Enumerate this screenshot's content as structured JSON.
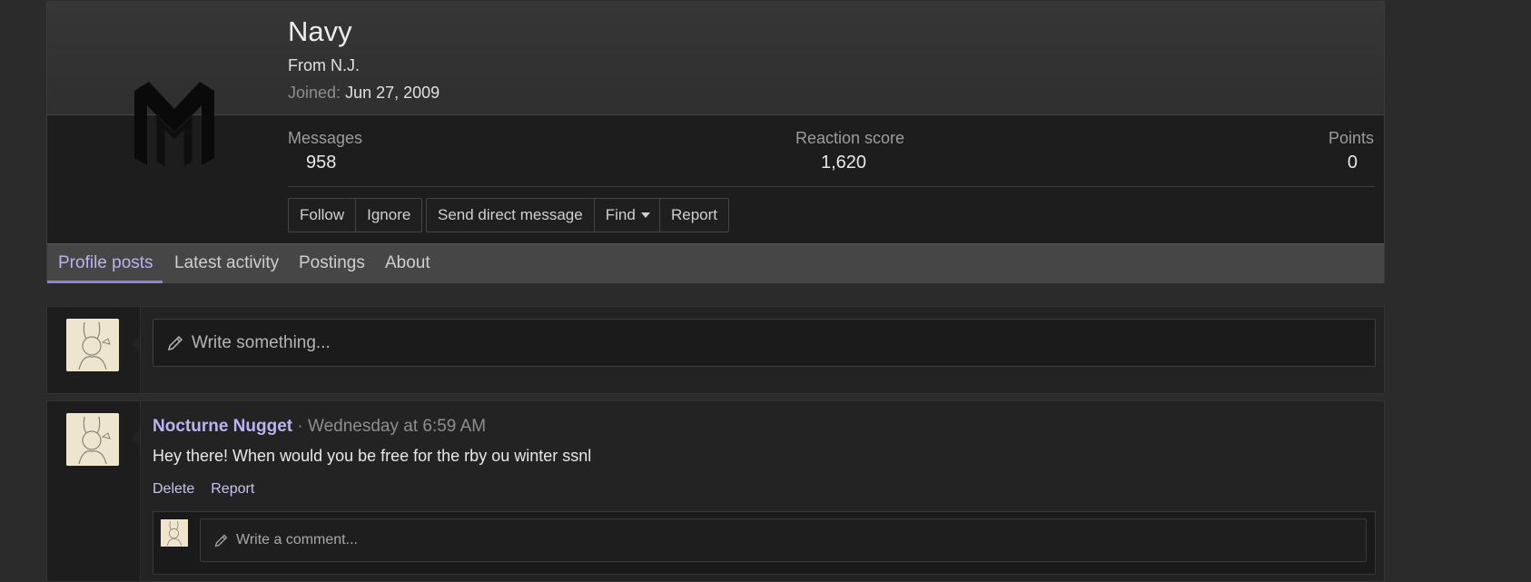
{
  "profile": {
    "username": "Navy",
    "location": "From N.J.",
    "joined_label": "Joined:",
    "joined_value": "Jun 27, 2009",
    "avatar_icon": "m-logo-icon",
    "stats": {
      "messages_label": "Messages",
      "messages_value": "958",
      "reaction_label": "Reaction score",
      "reaction_value": "1,620",
      "points_label": "Points",
      "points_value": "0"
    },
    "buttons": {
      "follow": "Follow",
      "ignore": "Ignore",
      "send_dm": "Send direct message",
      "find": "Find",
      "report": "Report"
    }
  },
  "tabs": [
    {
      "label": "Profile posts",
      "active": true
    },
    {
      "label": "Latest activity",
      "active": false
    },
    {
      "label": "Postings",
      "active": false
    },
    {
      "label": "About",
      "active": false
    }
  ],
  "compose": {
    "placeholder": "Write something...",
    "icon": "pencil-icon"
  },
  "post": {
    "author": "Nocturne Nugget",
    "separator": "·",
    "time": "Wednesday at 6:59 AM",
    "text": "Hey there! When would you be free for the rby ou winter ssnl",
    "actions": {
      "delete": "Delete",
      "report": "Report"
    },
    "comment_placeholder": "Write a comment..."
  },
  "colors": {
    "accent": "#b9b3f0",
    "tab_underline": "#8c85d9",
    "background": "#2b2b2b",
    "panel": "#1d1d1d"
  }
}
